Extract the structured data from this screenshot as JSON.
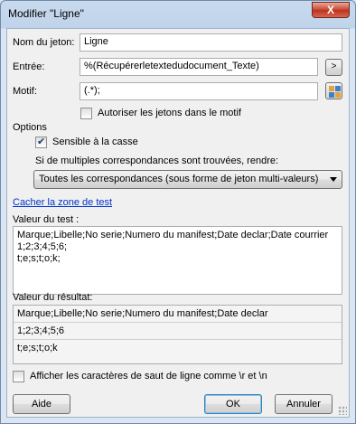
{
  "window": {
    "title": "Modifier \"Ligne\"",
    "close_glyph": "X"
  },
  "form": {
    "token_name_label": "Nom du jeton:",
    "token_name_value": "Ligne",
    "input_label": "Entrée:",
    "input_value": "%(Récupérerletextedudocument_Texte)",
    "input_button": ">",
    "pattern_label": "Motif:",
    "pattern_value": "(.*);",
    "allow_tokens_label": "Autoriser les jetons dans le motif",
    "allow_tokens_checked": false
  },
  "options": {
    "header": "Options",
    "case_sensitive_label": "Sensible à la casse",
    "case_sensitive_checked": true,
    "multiple_label": "Si de multiples correspondances sont trouvées, rendre:",
    "multiple_selected": "Toutes les correspondances (sous forme de jeton multi-valeurs)"
  },
  "test": {
    "hide_link": "Cacher la zone de test",
    "test_value_label": "Valeur du test :",
    "test_lines": [
      "Marque;Libelle;No serie;Numero du manifest;Date declar;Date courrier",
      "1;2;3;4;5;6;",
      "t;e;s;t;o;k;"
    ],
    "result_label": "Valeur du résultat:",
    "result_rows": [
      "Marque;Libelle;No serie;Numero du manifest;Date declar",
      "1;2;3;4;5;6",
      "t;e;s;t;o;k"
    ]
  },
  "footer": {
    "linebreak_label": "Afficher les caractères de saut de ligne comme \\r et \\n",
    "linebreak_checked": false,
    "help_button": "Aide",
    "ok_button": "OK",
    "cancel_button": "Annuler"
  }
}
